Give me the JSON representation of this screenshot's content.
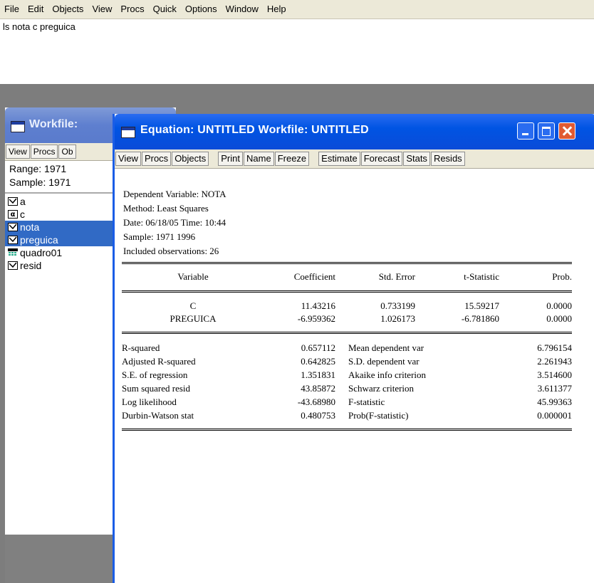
{
  "menu": [
    "File",
    "Edit",
    "Objects",
    "View",
    "Procs",
    "Quick",
    "Options",
    "Window",
    "Help"
  ],
  "command": "ls nota c preguica",
  "workfile": {
    "title": "Workfile:",
    "toolbar": [
      "View",
      "Procs",
      "Ob"
    ],
    "range": "Range:  1971",
    "sample": "Sample: 1971",
    "objects": [
      {
        "name": "a",
        "icon": "series-icon",
        "selected": false
      },
      {
        "name": "c",
        "icon": "coef-icon",
        "selected": false
      },
      {
        "name": "nota",
        "icon": "series-icon",
        "selected": true
      },
      {
        "name": "preguica",
        "icon": "series-icon",
        "selected": true
      },
      {
        "name": "quadro01",
        "icon": "table-icon",
        "selected": false
      },
      {
        "name": "resid",
        "icon": "series-icon",
        "selected": false
      }
    ]
  },
  "equation": {
    "title": "Equation: UNTITLED   Workfile: UNTITLED",
    "toolbar_group1": [
      "View",
      "Procs",
      "Objects"
    ],
    "toolbar_group2": [
      "Print",
      "Name",
      "Freeze"
    ],
    "toolbar_group3": [
      "Estimate",
      "Forecast",
      "Stats",
      "Resids"
    ],
    "header": {
      "dep": "Dependent Variable: NOTA",
      "method": "Method: Least Squares",
      "date": "Date: 06/18/05   Time: 10:44",
      "sample": "Sample: 1971 1996",
      "obs": "Included observations: 26"
    },
    "columns": [
      "Variable",
      "Coefficient",
      "Std. Error",
      "t-Statistic",
      "Prob."
    ],
    "coef_rows": [
      [
        "C",
        "11.43216",
        "0.733199",
        "15.59217",
        "0.0000"
      ],
      [
        "PREGUICA",
        "-6.959362",
        "1.026173",
        "-6.781860",
        "0.0000"
      ]
    ],
    "stats_rows": [
      [
        "R-squared",
        "0.657112",
        "Mean dependent var",
        "6.796154"
      ],
      [
        "Adjusted R-squared",
        "0.642825",
        "S.D. dependent var",
        "2.261943"
      ],
      [
        "S.E. of regression",
        "1.351831",
        "Akaike info criterion",
        "3.514600"
      ],
      [
        "Sum squared resid",
        "43.85872",
        "Schwarz criterion",
        "3.611377"
      ],
      [
        "Log likelihood",
        "-43.68980",
        "F-statistic",
        "45.99363"
      ],
      [
        "Durbin-Watson stat",
        "0.480753",
        "Prob(F-statistic)",
        "0.000001"
      ]
    ]
  },
  "colors": {
    "titlebar": "#0054e3",
    "workfile_titlebar": "#5e7fcf",
    "selection": "#316ac5",
    "close": "#e05a32"
  }
}
